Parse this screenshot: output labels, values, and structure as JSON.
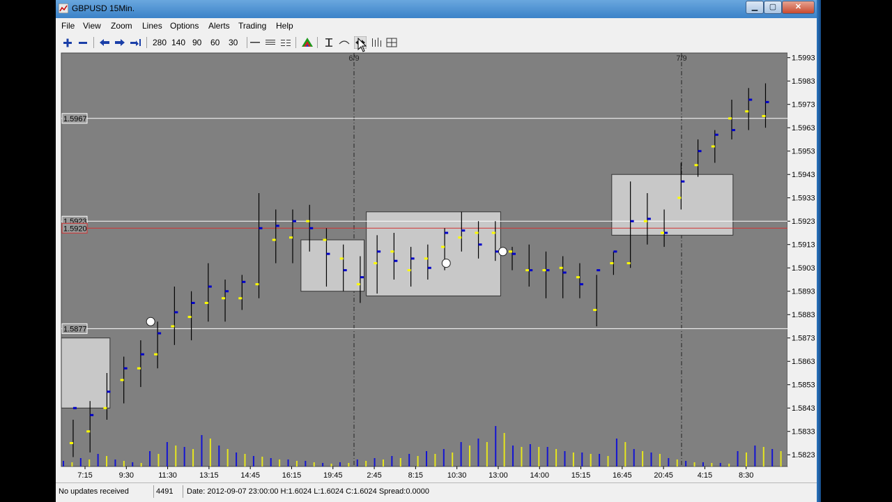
{
  "window": {
    "title": "GBPUSD 15Min.",
    "controls": {
      "minimize": "▁",
      "maximize": "▢",
      "close": "✕"
    }
  },
  "menu": [
    "File",
    "View",
    "Zoom",
    "Lines",
    "Options",
    "Alerts",
    "Trading",
    "Help"
  ],
  "toolbar": {
    "zoom_in_icon": "zoom-in-icon",
    "zoom_out_icon": "zoom-out-icon",
    "scroll_left_icon": "scroll-left-icon",
    "scroll_right_icon": "scroll-right-icon",
    "scroll_end_icon": "scroll-end-icon",
    "bar_counts": [
      "280",
      "140",
      "90",
      "60",
      "30"
    ],
    "line_tools": [
      "hline-icon",
      "dotted-line-icon",
      "dashed-line-icon"
    ],
    "indicator_icon": "color-pyramid-icon",
    "cursor_tools": [
      "crosshair-icon",
      "curve-icon",
      "pan-icon",
      "bars-icon",
      "layout-icon"
    ]
  },
  "colors": {
    "plot_bg": "#808080",
    "accent_red": "#d23232",
    "volume_blue": "#1414d2",
    "volume_yellow": "#e6e61e",
    "bar_black": "#000000",
    "close_blue": "#0000c8",
    "open_yellow": "#ffff00",
    "green_body": "#0a7a0a",
    "lime": "#b4f03c"
  },
  "chart_data": {
    "type": "bar",
    "symbol": "GBPUSD",
    "timeframe": "15Min.",
    "ylim": [
      1.5818,
      1.5995
    ],
    "y_ticks": [
      "1.5993",
      "1.5983",
      "1.5973",
      "1.5963",
      "1.5953",
      "1.5943",
      "1.5933",
      "1.5923",
      "1.5913",
      "1.5903",
      "1.5893",
      "1.5883",
      "1.5873",
      "1.5863",
      "1.5853",
      "1.5843",
      "1.5833",
      "1.5823"
    ],
    "x_ticks": [
      "7:15",
      "9:30",
      "11:30",
      "13:15",
      "14:45",
      "16:15",
      "19:45",
      "2:45",
      "8:15",
      "10:30",
      "13:00",
      "14:00",
      "15:15",
      "16:45",
      "20:45",
      "4:15",
      "8:30"
    ],
    "day_markers": [
      "6/9",
      "7/9"
    ],
    "horizontal_lines": [
      {
        "label": "1.5967",
        "value": 1.5967,
        "color": "#ffffff"
      },
      {
        "label": "1.5923",
        "value": 1.5923,
        "color": "#ffffff"
      },
      {
        "label": "1.5920",
        "value": 1.592,
        "color": "#d23232"
      },
      {
        "label": "1.5877",
        "value": 1.5877,
        "color": "#ffffff"
      }
    ],
    "bars": [
      {
        "t": 0,
        "h": 1.5838,
        "l": 1.5822,
        "o": 1.5828,
        "c": 1.5843
      },
      {
        "t": 1,
        "h": 1.5846,
        "l": 1.5824,
        "o": 1.5833,
        "c": 1.584
      },
      {
        "t": 2,
        "h": 1.5858,
        "l": 1.5838,
        "o": 1.5843,
        "c": 1.585
      },
      {
        "t": 3,
        "h": 1.5865,
        "l": 1.5845,
        "o": 1.5855,
        "c": 1.586
      },
      {
        "t": 4,
        "h": 1.5872,
        "l": 1.5852,
        "o": 1.586,
        "c": 1.5866
      },
      {
        "t": 5,
        "h": 1.588,
        "l": 1.586,
        "o": 1.5866,
        "c": 1.5875
      },
      {
        "t": 6,
        "h": 1.5895,
        "l": 1.587,
        "o": 1.5878,
        "c": 1.5884
      },
      {
        "t": 7,
        "h": 1.5893,
        "l": 1.5872,
        "o": 1.5882,
        "c": 1.5888
      },
      {
        "t": 8,
        "h": 1.5905,
        "l": 1.588,
        "o": 1.5888,
        "c": 1.5895
      },
      {
        "t": 9,
        "h": 1.5898,
        "l": 1.588,
        "o": 1.589,
        "c": 1.5893
      },
      {
        "t": 10,
        "h": 1.59,
        "l": 1.5885,
        "o": 1.589,
        "c": 1.5897
      },
      {
        "t": 11,
        "h": 1.5935,
        "l": 1.589,
        "o": 1.5896,
        "c": 1.592
      },
      {
        "t": 12,
        "h": 1.5928,
        "l": 1.5905,
        "o": 1.5915,
        "c": 1.5921
      },
      {
        "t": 13,
        "h": 1.5928,
        "l": 1.5905,
        "o": 1.5916,
        "c": 1.5923
      },
      {
        "t": 14,
        "h": 1.593,
        "l": 1.591,
        "o": 1.5923,
        "c": 1.592
      },
      {
        "t": 15,
        "h": 1.592,
        "l": 1.5895,
        "o": 1.5915,
        "c": 1.5909
      },
      {
        "t": 16,
        "h": 1.5913,
        "l": 1.5893,
        "o": 1.5907,
        "c": 1.5902
      },
      {
        "t": 17,
        "h": 1.5908,
        "l": 1.5888,
        "o": 1.5896,
        "c": 1.5899
      },
      {
        "t": 18,
        "h": 1.5917,
        "l": 1.5892,
        "o": 1.5905,
        "c": 1.591
      },
      {
        "t": 19,
        "h": 1.5918,
        "l": 1.5898,
        "o": 1.591,
        "c": 1.5906
      },
      {
        "t": 20,
        "h": 1.5912,
        "l": 1.5895,
        "o": 1.5902,
        "c": 1.5907
      },
      {
        "t": 21,
        "h": 1.5913,
        "l": 1.5898,
        "o": 1.5907,
        "c": 1.5903
      },
      {
        "t": 22,
        "h": 1.592,
        "l": 1.5902,
        "o": 1.5912,
        "c": 1.5918
      },
      {
        "t": 23,
        "h": 1.5927,
        "l": 1.591,
        "o": 1.5916,
        "c": 1.5919
      },
      {
        "t": 24,
        "h": 1.5923,
        "l": 1.5907,
        "o": 1.5918,
        "c": 1.5913
      },
      {
        "t": 25,
        "h": 1.5923,
        "l": 1.5906,
        "o": 1.5918,
        "c": 1.591
      },
      {
        "t": 26,
        "h": 1.5912,
        "l": 1.5902,
        "o": 1.591,
        "c": 1.5909
      },
      {
        "t": 27,
        "h": 1.5913,
        "l": 1.5895,
        "o": 1.5902,
        "c": 1.5902
      },
      {
        "t": 28,
        "h": 1.591,
        "l": 1.589,
        "o": 1.5902,
        "c": 1.5902
      },
      {
        "t": 29,
        "h": 1.5908,
        "l": 1.589,
        "o": 1.5903,
        "c": 1.5901
      },
      {
        "t": 30,
        "h": 1.5905,
        "l": 1.589,
        "o": 1.5899,
        "c": 1.5896
      },
      {
        "t": 31,
        "h": 1.59,
        "l": 1.5878,
        "o": 1.5885,
        "c": 1.5902
      },
      {
        "t": 32,
        "h": 1.591,
        "l": 1.59,
        "o": 1.5905,
        "c": 1.591
      },
      {
        "t": 33,
        "h": 1.594,
        "l": 1.5903,
        "o": 1.5905,
        "c": 1.5923
      },
      {
        "t": 34,
        "h": 1.5935,
        "l": 1.5913,
        "o": 1.5923,
        "c": 1.5924
      },
      {
        "t": 35,
        "h": 1.5928,
        "l": 1.5912,
        "o": 1.5918,
        "c": 1.5918
      },
      {
        "t": 36,
        "h": 1.5948,
        "l": 1.5928,
        "o": 1.5933,
        "c": 1.594
      },
      {
        "t": 37,
        "h": 1.5958,
        "l": 1.5942,
        "o": 1.5947,
        "c": 1.5953
      },
      {
        "t": 38,
        "h": 1.5962,
        "l": 1.5948,
        "o": 1.5955,
        "c": 1.596
      },
      {
        "t": 39,
        "h": 1.5975,
        "l": 1.5958,
        "o": 1.5967,
        "c": 1.5962
      },
      {
        "t": 40,
        "h": 1.598,
        "l": 1.5962,
        "o": 1.597,
        "c": 1.5975
      },
      {
        "t": 41,
        "h": 1.5982,
        "l": 1.5963,
        "o": 1.5968,
        "c": 1.5974
      }
    ],
    "volume": {
      "max_label": "",
      "values_blue": [
        0.08,
        0.12,
        0.18,
        0.1,
        0.06,
        0.22,
        0.35,
        0.28,
        0.45,
        0.3,
        0.2,
        0.15,
        0.12,
        0.1,
        0.08,
        0.05,
        0.06,
        0.1,
        0.12,
        0.15,
        0.18,
        0.22,
        0.25,
        0.35,
        0.4,
        0.58,
        0.3,
        0.32,
        0.28,
        0.22,
        0.2,
        0.18,
        0.4,
        0.25,
        0.2,
        0.12,
        0.08,
        0.06,
        0.05,
        0.22,
        0.3,
        0.25
      ],
      "values_yellow": [
        0.06,
        0.1,
        0.15,
        0.08,
        0.05,
        0.18,
        0.3,
        0.25,
        0.4,
        0.25,
        0.18,
        0.14,
        0.1,
        0.08,
        0.06,
        0.04,
        0.05,
        0.08,
        0.1,
        0.12,
        0.15,
        0.18,
        0.2,
        0.3,
        0.35,
        0.48,
        0.28,
        0.28,
        0.25,
        0.2,
        0.18,
        0.15,
        0.35,
        0.22,
        0.18,
        0.1,
        0.06,
        0.05,
        0.04,
        0.2,
        0.28,
        0.22
      ]
    },
    "zones": [
      {
        "x0": 0.0,
        "x1": 0.067,
        "top": 1.5873,
        "bottom": 1.5843
      },
      {
        "x0": 0.33,
        "x1": 0.417,
        "top": 1.5915,
        "bottom": 1.5893
      },
      {
        "x0": 0.42,
        "x1": 0.605,
        "top": 1.5927,
        "bottom": 1.5891
      },
      {
        "x0": 0.758,
        "x1": 0.925,
        "top": 1.5943,
        "bottom": 1.5917
      }
    ],
    "markers": [
      {
        "x": 0.123,
        "y": 1.588
      },
      {
        "x": 0.53,
        "y": 1.5905
      },
      {
        "x": 0.608,
        "y": 1.591
      }
    ]
  },
  "status": {
    "message": "No updates received",
    "count": "4491",
    "info": "Date: 2012-09-07 23:00:00 H:1.6024 L:1.6024 C:1.6024 Spread:0.0000"
  }
}
